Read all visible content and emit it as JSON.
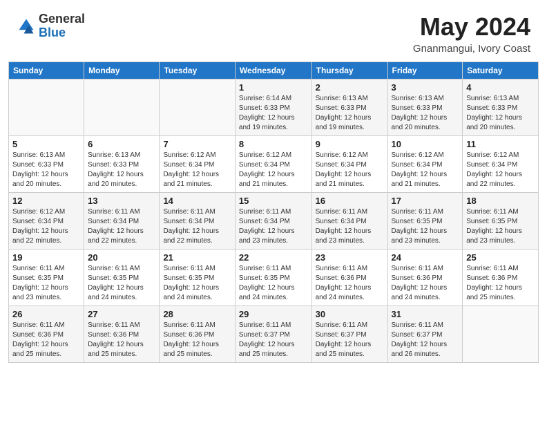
{
  "header": {
    "logo_general": "General",
    "logo_blue": "Blue",
    "month_year": "May 2024",
    "location": "Gnanmangui, Ivory Coast"
  },
  "days_of_week": [
    "Sunday",
    "Monday",
    "Tuesday",
    "Wednesday",
    "Thursday",
    "Friday",
    "Saturday"
  ],
  "weeks": [
    [
      {
        "day": "",
        "info": ""
      },
      {
        "day": "",
        "info": ""
      },
      {
        "day": "",
        "info": ""
      },
      {
        "day": "1",
        "info": "Sunrise: 6:14 AM\nSunset: 6:33 PM\nDaylight: 12 hours\nand 19 minutes."
      },
      {
        "day": "2",
        "info": "Sunrise: 6:13 AM\nSunset: 6:33 PM\nDaylight: 12 hours\nand 19 minutes."
      },
      {
        "day": "3",
        "info": "Sunrise: 6:13 AM\nSunset: 6:33 PM\nDaylight: 12 hours\nand 20 minutes."
      },
      {
        "day": "4",
        "info": "Sunrise: 6:13 AM\nSunset: 6:33 PM\nDaylight: 12 hours\nand 20 minutes."
      }
    ],
    [
      {
        "day": "5",
        "info": "Sunrise: 6:13 AM\nSunset: 6:33 PM\nDaylight: 12 hours\nand 20 minutes."
      },
      {
        "day": "6",
        "info": "Sunrise: 6:13 AM\nSunset: 6:33 PM\nDaylight: 12 hours\nand 20 minutes."
      },
      {
        "day": "7",
        "info": "Sunrise: 6:12 AM\nSunset: 6:34 PM\nDaylight: 12 hours\nand 21 minutes."
      },
      {
        "day": "8",
        "info": "Sunrise: 6:12 AM\nSunset: 6:34 PM\nDaylight: 12 hours\nand 21 minutes."
      },
      {
        "day": "9",
        "info": "Sunrise: 6:12 AM\nSunset: 6:34 PM\nDaylight: 12 hours\nand 21 minutes."
      },
      {
        "day": "10",
        "info": "Sunrise: 6:12 AM\nSunset: 6:34 PM\nDaylight: 12 hours\nand 21 minutes."
      },
      {
        "day": "11",
        "info": "Sunrise: 6:12 AM\nSunset: 6:34 PM\nDaylight: 12 hours\nand 22 minutes."
      }
    ],
    [
      {
        "day": "12",
        "info": "Sunrise: 6:12 AM\nSunset: 6:34 PM\nDaylight: 12 hours\nand 22 minutes."
      },
      {
        "day": "13",
        "info": "Sunrise: 6:11 AM\nSunset: 6:34 PM\nDaylight: 12 hours\nand 22 minutes."
      },
      {
        "day": "14",
        "info": "Sunrise: 6:11 AM\nSunset: 6:34 PM\nDaylight: 12 hours\nand 22 minutes."
      },
      {
        "day": "15",
        "info": "Sunrise: 6:11 AM\nSunset: 6:34 PM\nDaylight: 12 hours\nand 23 minutes."
      },
      {
        "day": "16",
        "info": "Sunrise: 6:11 AM\nSunset: 6:34 PM\nDaylight: 12 hours\nand 23 minutes."
      },
      {
        "day": "17",
        "info": "Sunrise: 6:11 AM\nSunset: 6:35 PM\nDaylight: 12 hours\nand 23 minutes."
      },
      {
        "day": "18",
        "info": "Sunrise: 6:11 AM\nSunset: 6:35 PM\nDaylight: 12 hours\nand 23 minutes."
      }
    ],
    [
      {
        "day": "19",
        "info": "Sunrise: 6:11 AM\nSunset: 6:35 PM\nDaylight: 12 hours\nand 23 minutes."
      },
      {
        "day": "20",
        "info": "Sunrise: 6:11 AM\nSunset: 6:35 PM\nDaylight: 12 hours\nand 24 minutes."
      },
      {
        "day": "21",
        "info": "Sunrise: 6:11 AM\nSunset: 6:35 PM\nDaylight: 12 hours\nand 24 minutes."
      },
      {
        "day": "22",
        "info": "Sunrise: 6:11 AM\nSunset: 6:35 PM\nDaylight: 12 hours\nand 24 minutes."
      },
      {
        "day": "23",
        "info": "Sunrise: 6:11 AM\nSunset: 6:36 PM\nDaylight: 12 hours\nand 24 minutes."
      },
      {
        "day": "24",
        "info": "Sunrise: 6:11 AM\nSunset: 6:36 PM\nDaylight: 12 hours\nand 24 minutes."
      },
      {
        "day": "25",
        "info": "Sunrise: 6:11 AM\nSunset: 6:36 PM\nDaylight: 12 hours\nand 25 minutes."
      }
    ],
    [
      {
        "day": "26",
        "info": "Sunrise: 6:11 AM\nSunset: 6:36 PM\nDaylight: 12 hours\nand 25 minutes."
      },
      {
        "day": "27",
        "info": "Sunrise: 6:11 AM\nSunset: 6:36 PM\nDaylight: 12 hours\nand 25 minutes."
      },
      {
        "day": "28",
        "info": "Sunrise: 6:11 AM\nSunset: 6:36 PM\nDaylight: 12 hours\nand 25 minutes."
      },
      {
        "day": "29",
        "info": "Sunrise: 6:11 AM\nSunset: 6:37 PM\nDaylight: 12 hours\nand 25 minutes."
      },
      {
        "day": "30",
        "info": "Sunrise: 6:11 AM\nSunset: 6:37 PM\nDaylight: 12 hours\nand 25 minutes."
      },
      {
        "day": "31",
        "info": "Sunrise: 6:11 AM\nSunset: 6:37 PM\nDaylight: 12 hours\nand 26 minutes."
      },
      {
        "day": "",
        "info": ""
      }
    ]
  ]
}
